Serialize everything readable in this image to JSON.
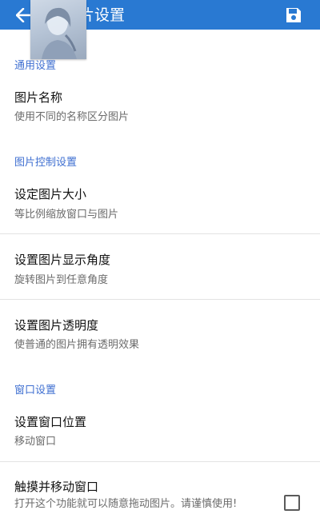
{
  "appbar": {
    "title": "图片设置",
    "back_icon": "arrow-back-icon",
    "save_icon": "floppy-disk-icon",
    "background": "#2979d2"
  },
  "sections": [
    {
      "header": "通用设置",
      "items": [
        {
          "title": "图片名称",
          "subtitle": "使用不同的名称区分图片"
        }
      ]
    },
    {
      "header": "图片控制设置",
      "items": [
        {
          "title": "设定图片大小",
          "subtitle": "等比例缩放窗口与图片"
        },
        {
          "title": "设置图片显示角度",
          "subtitle": "旋转图片到任意角度"
        },
        {
          "title": "设置图片透明度",
          "subtitle": "使普通的图片拥有透明效果"
        }
      ]
    },
    {
      "header": "窗口设置",
      "items": [
        {
          "title": "设置窗口位置",
          "subtitle": "移动窗口"
        },
        {
          "title": "触摸并移动窗口",
          "subtitle": "打开这个功能就可以随意拖动图片。请谨慎使用!",
          "checkbox_checked": false
        }
      ]
    }
  ],
  "accent_color": "#3f6fd1"
}
